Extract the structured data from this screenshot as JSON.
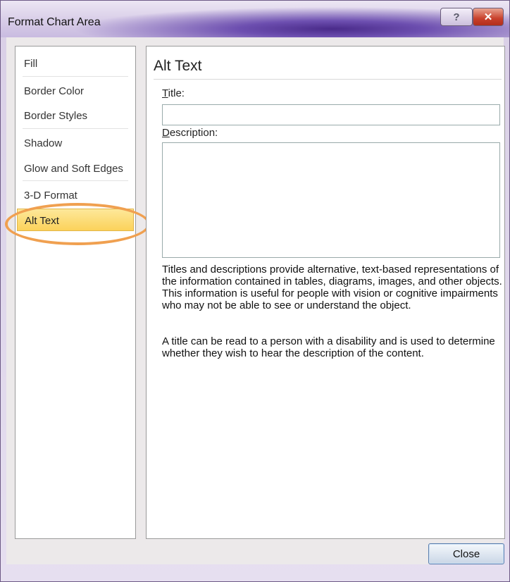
{
  "window": {
    "title": "Format Chart Area",
    "help_glyph": "?",
    "close_glyph": "✕"
  },
  "sidebar": {
    "items": [
      {
        "label": "Fill"
      },
      {
        "label": "Border Color"
      },
      {
        "label": "Border Styles"
      },
      {
        "label": "Shadow"
      },
      {
        "label": "Glow and Soft Edges"
      },
      {
        "label": "3-D Format"
      },
      {
        "label": "Alt Text",
        "selected": true
      }
    ]
  },
  "panel": {
    "heading": "Alt Text",
    "title_label_first": "T",
    "title_label_rest": "itle:",
    "title_value": "",
    "description_label_first": "D",
    "description_label_rest": "escription:",
    "description_value": "",
    "info_paragraph_1": "Titles and descriptions provide alternative, text-based representations of the information contained in tables, diagrams, images, and other objects. This information is useful for people with vision or cognitive impairments who may not be able to see or understand the object.",
    "info_paragraph_2": "A title can be read to a person with a disability and is used to determine whether they wish to hear the description of the content."
  },
  "footer": {
    "close_label": "Close"
  },
  "colors": {
    "selected_item": "#fcd25a",
    "highlight_ring": "#f0a050",
    "close_x_button": "#c8402b"
  }
}
